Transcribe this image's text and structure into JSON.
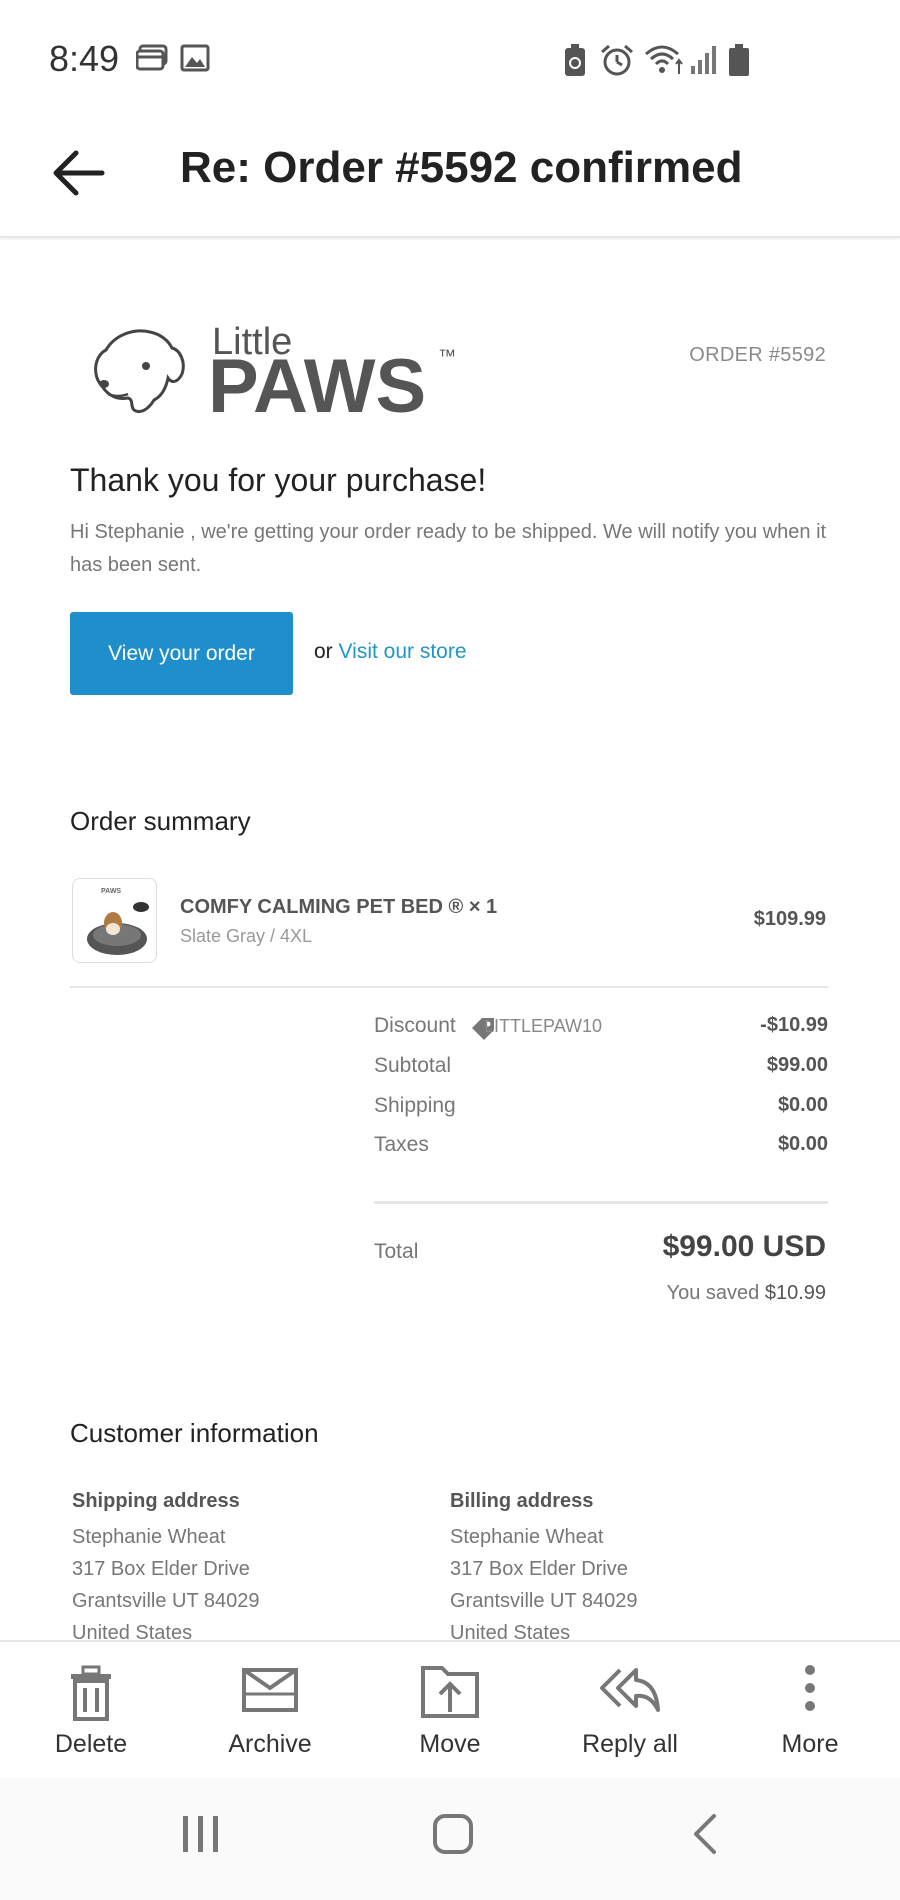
{
  "status_bar": {
    "time": "8:49",
    "icons": [
      "card-icon",
      "image-icon",
      "battery-saver-icon",
      "alarm-icon",
      "wifi-icon",
      "signal-icon",
      "battery-icon"
    ]
  },
  "header": {
    "subject": "Re: Order #5592 confirmed"
  },
  "email": {
    "brand": {
      "small": "Little",
      "large": "PAWS",
      "tm": "™"
    },
    "order_number": "ORDER #5592",
    "thanks": "Thank you for your purchase!",
    "intro": "Hi Stephanie , we're getting your order ready to be shipped. We will notify you when it has been sent.",
    "view_order_label": "View your order",
    "or_text": "or",
    "visit_store_label": "Visit our store",
    "order_summary_title": "Order summary",
    "product": {
      "thumb_label": "PAWS",
      "name": "COMFY CALMING PET BED ® × 1",
      "variant": "Slate Gray / 4XL",
      "price": "$109.99"
    },
    "discount": {
      "label": "Discount",
      "code": "LITTLEPAW10",
      "value": "-$10.99"
    },
    "subtotal": {
      "label": "Subtotal",
      "value": "$99.00"
    },
    "shipping": {
      "label": "Shipping",
      "value": "$0.00"
    },
    "taxes": {
      "label": "Taxes",
      "value": "$0.00"
    },
    "total": {
      "label": "Total",
      "value": "$99.00 USD"
    },
    "saved": {
      "prefix": "You saved",
      "amount": "$10.99"
    },
    "customer_info_title": "Customer information",
    "shipping_address": {
      "title": "Shipping address",
      "lines": [
        "Stephanie Wheat",
        "317 Box Elder Drive",
        "Grantsville UT 84029",
        "United States"
      ]
    },
    "billing_address": {
      "title": "Billing address",
      "lines": [
        "Stephanie Wheat",
        "317 Box Elder Drive",
        "Grantsville UT 84029",
        "United States"
      ]
    }
  },
  "toolbar": {
    "delete": "Delete",
    "archive": "Archive",
    "move": "Move",
    "reply_all": "Reply all",
    "more": "More"
  },
  "colors": {
    "accent": "#1f8fcc",
    "link": "#2196c8",
    "text_dark": "#222222",
    "text_muted": "#777777"
  }
}
